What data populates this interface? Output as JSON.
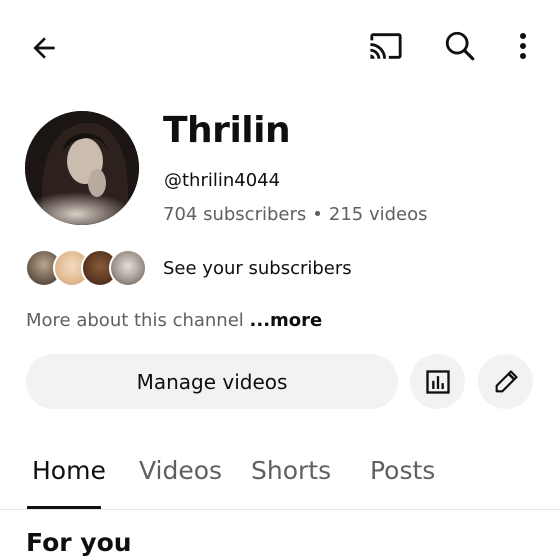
{
  "header": {
    "back_icon": "arrow-back-icon",
    "cast_icon": "cast-icon",
    "search_icon": "search-icon",
    "menu_icon": "more-vertical-icon"
  },
  "channel": {
    "name": "Thrilin",
    "handle": "@thrilin4044",
    "subscribers": "704 subscribers",
    "separator": "•",
    "videos": "215 videos"
  },
  "subscribers_row": {
    "label": "See your subscribers",
    "avatar_colors": [
      "#8c7b6a",
      "#e8c9a8",
      "#6b4a32",
      "#cfcfcf"
    ]
  },
  "about": {
    "text": "More about this channel ",
    "more": "...more"
  },
  "actions": {
    "manage_label": "Manage videos",
    "analytics_icon": "analytics-icon",
    "edit_icon": "edit-pencil-icon"
  },
  "tabs": [
    {
      "label": "Home",
      "active": true
    },
    {
      "label": "Videos",
      "active": false
    },
    {
      "label": "Shorts",
      "active": false
    },
    {
      "label": "Posts",
      "active": false
    }
  ],
  "section": {
    "title": "For you"
  },
  "colors": {
    "text_primary": "#0f0f0f",
    "text_secondary": "#606060",
    "button_bg": "#f2f2f2"
  }
}
